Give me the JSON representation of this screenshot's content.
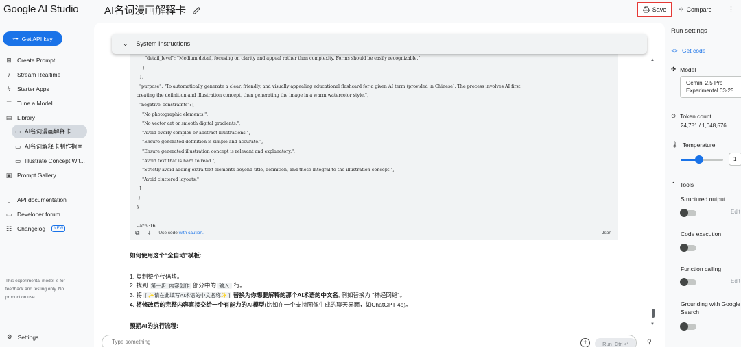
{
  "header": {
    "logo": "Google AI Studio",
    "title": "AI名词漫画解释卡",
    "save_label": "Save",
    "compare_label": "Compare"
  },
  "sidebar": {
    "api_key_label": "Get API key",
    "items": [
      {
        "label": "Create Prompt",
        "icon": "create-prompt-icon"
      },
      {
        "label": "Stream Realtime",
        "icon": "mic-icon"
      },
      {
        "label": "Starter Apps",
        "icon": "bolt-icon"
      },
      {
        "label": "Tune a Model",
        "icon": "tune-icon"
      },
      {
        "label": "Library",
        "icon": "library-icon"
      }
    ],
    "library_items": [
      {
        "label": "AI名词漫画解释卡",
        "active": true
      },
      {
        "label": "AI名词解释卡制作指南",
        "active": false
      },
      {
        "label": "Illustrate Concept Wit...",
        "active": false
      }
    ],
    "prompt_gallery": "Prompt Gallery",
    "links": [
      {
        "label": "API documentation"
      },
      {
        "label": "Developer forum"
      },
      {
        "label": "Changelog",
        "badge": "NEW"
      }
    ],
    "disclaimer": "This experimental model is for feedback and testing only. No production use.",
    "settings_label": "Settings"
  },
  "main": {
    "system_instructions_label": "System Instructions",
    "code_lines": [
      "      \"detail_level\": \"Medium detail, focusing on clarity and appeal rather than complexity. Forms should be easily recognizable.\"",
      "    }",
      "  },",
      "  \"purpose\": \"To automatically generate a clear, friendly, and visually appealing educational flashcard for a given AI term (provided in Chinese). The process involves AI first",
      "creating the definition and illustration concept, then generating the image in a warm watercolor style.\",",
      "  \"negative_constraints\": [",
      "    \"No photographic elements.\",",
      "    \"No vector art or smooth digital gradients.\",",
      "    \"Avoid overly complex or abstract illustrations.\",",
      "    \"Ensure generated definition is simple and accurate.\",",
      "    \"Ensure generated illustration concept is relevant and explanatory.\",",
      "    \"Avoid text that is hard to read.\",",
      "    \"Strictly avoid adding extra text elements beyond title, definition, and those integral to the illustration concept.\",",
      "    \"Avoid cluttered layouts.\"",
      "  ]",
      " }",
      "}",
      "",
      "--ar 9:16"
    ],
    "code_footer": {
      "use_code": "Use code ",
      "with_caution": "with caution.",
      "lang": "Json"
    },
    "heading1": "如何使用这个“全自动”模板:",
    "steps": {
      "s1": "1. 复制整个代码块。",
      "s2_pre": "2. 找到",
      "s2_code1": "第一步: 内容创作",
      "s2_mid": "部分中的",
      "s2_code2": "输入:",
      "s2_post": "行。",
      "s3_pre": "3. 将",
      "s3_code": "[ ✨请在此填写AI术语的中文名称✨ ]",
      "s3_bold": "替换为你想要解释的那个AI术语的中文名",
      "s3_post": ", 例如替换为 \"神经网络\"。",
      "s4_bold": "4. 将修改后的完整内容直接交给一个有能力的AI模型",
      "s4_post": "(比如在一个支持图像生成的聊天界面，如ChatGPT 4o)。"
    },
    "heading2": "预期AI的执行流程:",
    "input_placeholder": "Type something",
    "run_label": "Run",
    "run_shortcut": "Ctrl ↵"
  },
  "run_settings": {
    "title": "Run settings",
    "get_code": "Get code",
    "model_label": "Model",
    "model_line1": "Gemini 2.5 Pro",
    "model_line2": "Experimental 03-25",
    "token_label": "Token count",
    "token_value": "24,781 / 1,048,576",
    "temperature_label": "Temperature",
    "temperature_fraction": 0.5,
    "temperature_value": "1",
    "tools_label": "Tools",
    "tools": {
      "structured_output": "Structured output",
      "code_execution": "Code execution",
      "function_calling": "Function calling",
      "grounding": "Grounding with Google Search"
    },
    "edit_label": "Edit"
  },
  "colors": {
    "accent": "#1a73e8",
    "save_highlight": "#e53935"
  }
}
